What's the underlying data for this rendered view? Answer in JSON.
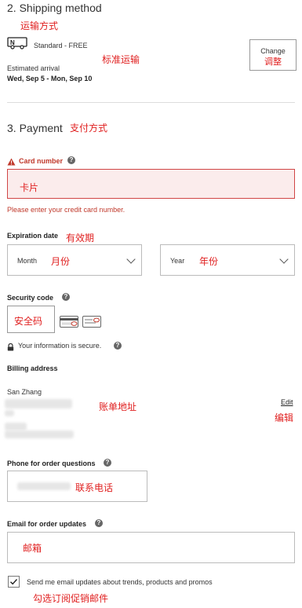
{
  "shipping": {
    "heading": "2. Shipping method",
    "heading_cn": "运输方式",
    "option": "Standard - FREE",
    "option_cn": "标准运输",
    "arrival_label": "Estimated arrival",
    "arrival_dates": "Wed, Sep 5 - Mon, Sep 10",
    "change_label": "Change",
    "change_cn": "调整"
  },
  "payment": {
    "heading": "3. Payment",
    "heading_cn": "支付方式",
    "card_label": "Card number",
    "card_placeholder_cn": "卡片",
    "card_error": "Please enter your credit card number.",
    "expiration_label": "Expiration date",
    "expiration_cn": "有效期",
    "month_label": "Month",
    "month_cn": "月份",
    "year_label": "Year",
    "year_cn": "年份",
    "security_label": "Security code",
    "security_cn": "安全码",
    "secure_note": "Your information is secure.",
    "billing_label": "Billing address",
    "billing_name": "San Zhang",
    "billing_cn": "账单地址",
    "edit_label": "Edit",
    "edit_cn": "编辑",
    "phone_label": "Phone for order questions",
    "phone_cn": "联系电话",
    "email_label": "Email for order updates",
    "email_cn": "邮箱",
    "promo_label": "Send me email updates about trends, products and promos",
    "promo_cn": "勾选订阅促销邮件",
    "promo_checked": true
  },
  "colors": {
    "error": "#c0392b",
    "annotation": "#e02020"
  }
}
